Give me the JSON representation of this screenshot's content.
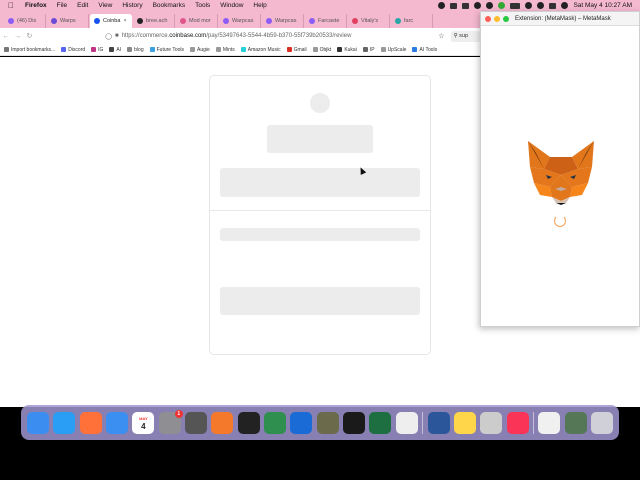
{
  "menubar": {
    "app": "Firefox",
    "items": [
      "File",
      "Edit",
      "View",
      "History",
      "Bookmarks",
      "Tools",
      "Window",
      "Help"
    ],
    "datetime": "Sat May 4  10:27 AM"
  },
  "tabs": [
    {
      "label": "(46) Dis",
      "color": "#8b5cf6"
    },
    {
      "label": "Warps",
      "color": "#6b4bd6"
    },
    {
      "label": "Coinba",
      "color": "#1652f0",
      "active": true
    },
    {
      "label": "bree.ach",
      "color": "#222222"
    },
    {
      "label": "Mod mor",
      "color": "#e0568c"
    },
    {
      "label": "Warpcas",
      "color": "#8b5cf6"
    },
    {
      "label": "Warpcas",
      "color": "#8b5cf6"
    },
    {
      "label": "Farcaste",
      "color": "#8b5cf6"
    },
    {
      "label": "Vitaly's",
      "color": "#e04060"
    },
    {
      "label": "farc",
      "color": "#2aa6a6"
    }
  ],
  "nav": {
    "url_prefix": "https://commerce.",
    "url_domain": "coinbase.com",
    "url_path": "/pay/53497643-5544-4b59-b370-55f739b20533/review",
    "search": "sup"
  },
  "bookmarks": [
    {
      "label": "Import bookmarks...",
      "color": "#777777"
    },
    {
      "label": "Discord",
      "color": "#5865f2"
    },
    {
      "label": "IG",
      "color": "#c13584"
    },
    {
      "label": "AI",
      "color": "#444444"
    },
    {
      "label": "blog",
      "color": "#888888"
    },
    {
      "label": "Future Tools",
      "color": "#3aa0e0"
    },
    {
      "label": "Augie",
      "color": "#999999"
    },
    {
      "label": "Mints",
      "color": "#999999"
    },
    {
      "label": "Amazon Music",
      "color": "#25d1da"
    },
    {
      "label": "Gmail",
      "color": "#d93025"
    },
    {
      "label": "Objkt",
      "color": "#999999"
    },
    {
      "label": "Kukai",
      "color": "#333333"
    },
    {
      "label": "IP",
      "color": "#666666"
    },
    {
      "label": "UpScale",
      "color": "#999999"
    },
    {
      "label": "AI Tools",
      "color": "#2a7ae2"
    }
  ],
  "metamask": {
    "title": "Extension: (MetaMask) – MetaMask"
  },
  "dock": [
    {
      "name": "finder-icon",
      "color": "#3b8ef0"
    },
    {
      "name": "safari-icon",
      "color": "#2a9df4"
    },
    {
      "name": "firefox-icon",
      "color": "#ff7139"
    },
    {
      "name": "mail-icon",
      "color": "#3a8ff0"
    },
    {
      "name": "calendar-icon",
      "color": "#ffffff",
      "text": "4",
      "sub": "MAY"
    },
    {
      "name": "system-settings-icon",
      "color": "#8e8e93",
      "badge": "1"
    },
    {
      "name": "calculator-icon",
      "color": "#555555"
    },
    {
      "name": "blender-icon",
      "color": "#f5792a"
    },
    {
      "name": "scrivener-icon",
      "color": "#222222"
    },
    {
      "name": "app-icon",
      "color": "#2f8f4f"
    },
    {
      "name": "quicktime-icon",
      "color": "#1a6bd6"
    },
    {
      "name": "gimp-icon",
      "color": "#6b6b4b"
    },
    {
      "name": "screenshot-icon",
      "color": "#1a1a1a"
    },
    {
      "name": "excel-icon",
      "color": "#1d6f42"
    },
    {
      "name": "notes-pad-icon",
      "color": "#eeeeee"
    },
    {
      "name": "word-icon",
      "color": "#2b579a"
    },
    {
      "name": "notes-icon",
      "color": "#ffd54a"
    },
    {
      "name": "preview-icon",
      "color": "#cccccc"
    },
    {
      "name": "music-icon",
      "color": "#fa3456"
    },
    {
      "name": "app2-icon",
      "color": "#f0f0f0"
    },
    {
      "name": "photos-folder-icon",
      "color": "#557755"
    },
    {
      "name": "trash-icon",
      "color": "#d0d0d8"
    }
  ]
}
